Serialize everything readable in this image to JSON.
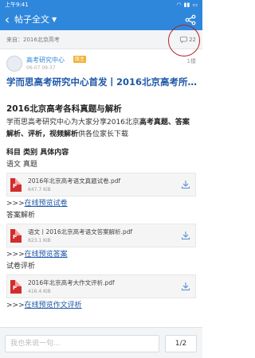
{
  "status_bar": {
    "time": "上午9:41"
  },
  "header": {
    "title": "帖子全文",
    "back_icon": "back-chevron-icon",
    "share_icon": "share-icon"
  },
  "meta": {
    "source": "来自：2016北京高考",
    "reply_count": "22",
    "reply_icon": "comment-bubble-icon"
  },
  "author": {
    "name": "高考研究中心",
    "badge": "版主",
    "time": "06-07 09:37",
    "floor": "1楼"
  },
  "post_title": "学而思高考研究中心首发丨2016北京高考所…",
  "content": {
    "heading": "2016北京高考各科真题与解析",
    "intro_prefix": "学而思高考研究中心为大家分享2016北京",
    "intro_bold": "高考真题、答案解析、评析，视频解析",
    "intro_suffix": "供各位家长下载",
    "columns": "科目 类别 具体内容",
    "sections": [
      {
        "label": "语文 真题",
        "file": {
          "name": "2016年北京高考语文真题试卷.pdf",
          "size": "647.7 KiB"
        },
        "link_prefix": ">>>",
        "link_text": "在线预览试卷"
      },
      {
        "label": "答案解析",
        "file": {
          "name": "语文丨2016北京高考语文答案解析.pdf",
          "size": "823.1 KiB"
        },
        "link_prefix": ">>>",
        "link_text": "在线预览答案"
      },
      {
        "label": "试卷评析",
        "file": {
          "name": "2016年北京高考大作文评析.pdf",
          "size": "416.4 KiB"
        },
        "link_prefix": ">>>",
        "link_text": "在线预览作文评析"
      }
    ]
  },
  "bottom": {
    "placeholder": "我也来说一句...",
    "page": "1/2"
  },
  "colors": {
    "primary": "#2f87dc",
    "title_blue": "#1e57a8",
    "pdf_red": "#d32c2c",
    "badge": "#f0b23a",
    "annotation_circle": "#b52127"
  }
}
